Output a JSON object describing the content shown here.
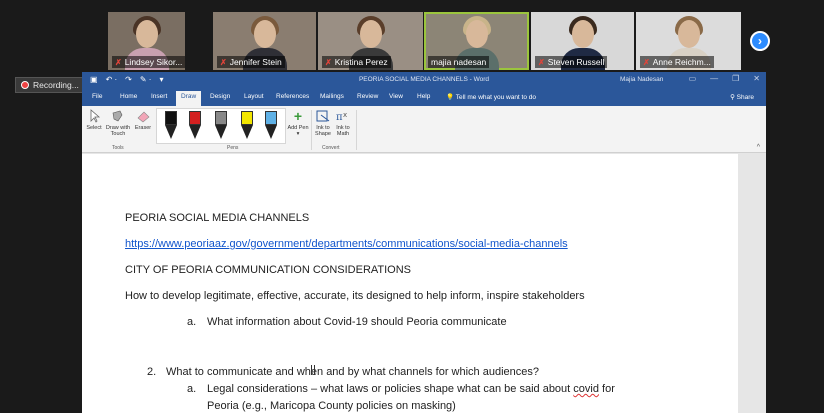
{
  "participants": [
    {
      "name": "Lindsey Sikor...",
      "muted": true,
      "shirt": "#c9a0b0",
      "hair": "#4a3426",
      "bg": "#7a6e62"
    },
    {
      "name": "Jennifer Stein",
      "muted": true,
      "shirt": "#2f2f36",
      "hair": "#7a5a3c",
      "bg": "#8a7d70"
    },
    {
      "name": "Kristina Perez",
      "muted": true,
      "shirt": "#3a3a3a",
      "hair": "#5a3e2a",
      "bg": "#9a8f84"
    },
    {
      "name": "majia nadesan",
      "muted": false,
      "shirt": "#5b6f6a",
      "hair": "#c9b48a",
      "bg": "#8c8576"
    },
    {
      "name": "Steven Russell",
      "muted": true,
      "shirt": "#1f2a44",
      "hair": "#3a2a1e",
      "bg": "#d8d8d8"
    },
    {
      "name": "Anne Reichm...",
      "muted": true,
      "shirt": "#d9d1c4",
      "hair": "#8a6a48",
      "bg": "#dcdcdc"
    }
  ],
  "next_button": "›",
  "recording": {
    "label": "Recording..."
  },
  "word": {
    "quick_access": [
      "▣",
      "↶ ·",
      "↷",
      "✎ ·",
      "▾"
    ],
    "title": "PEORIA SOCIAL MEDIA CHANNELS - Word",
    "user": "Majia Nadesan",
    "window_controls": [
      "▭",
      "—",
      "❐",
      "✕"
    ],
    "menu": [
      "File",
      "Home",
      "Insert",
      "Draw",
      "Design",
      "Layout",
      "References",
      "Mailings",
      "Review",
      "View",
      "Help"
    ],
    "active_menu": "Draw",
    "tell_me": "Tell me what you want to do",
    "share": "Share",
    "tools": {
      "select": "Select",
      "draw_touch": "Draw with Touch",
      "eraser": "Eraser",
      "group": "Tools"
    },
    "pens": {
      "group": "Pens",
      "colors": [
        "#111111",
        "#d42020",
        "#888888",
        "#f3e600",
        "#5fb1e6"
      ]
    },
    "add_pen": "Add Pen ▾",
    "convert": {
      "ink_to_shape": "Ink to Shape",
      "ink_to_math": "Ink to Math",
      "group": "Convert"
    },
    "collapse": "^"
  },
  "document": {
    "heading": "PEORIA SOCIAL MEDIA CHANNELS",
    "link": "https://www.peoriaaz.gov/government/departments/communications/social-media-channels",
    "subheading": "CITY OF PEORIA COMMUNICATION CONSIDERATIONS",
    "intro": "How to develop legitimate, effective, accurate, its designed to help inform, inspire stakeholders",
    "item_a1_marker": "a.",
    "item_a1": "What information about Covid-19 should Peoria communicate",
    "item_2_marker": "2.",
    "item_2": "What to communicate and when and by what channels for which audiences?",
    "item_a2_marker": "a.",
    "item_a2_before": "Legal considerations – what laws or policies shape what can be said about ",
    "item_a2_flagged": "covid",
    "item_a2_after": " for",
    "item_a2_cont": "Peoria (e.g., Maricopa County policies on masking)"
  }
}
